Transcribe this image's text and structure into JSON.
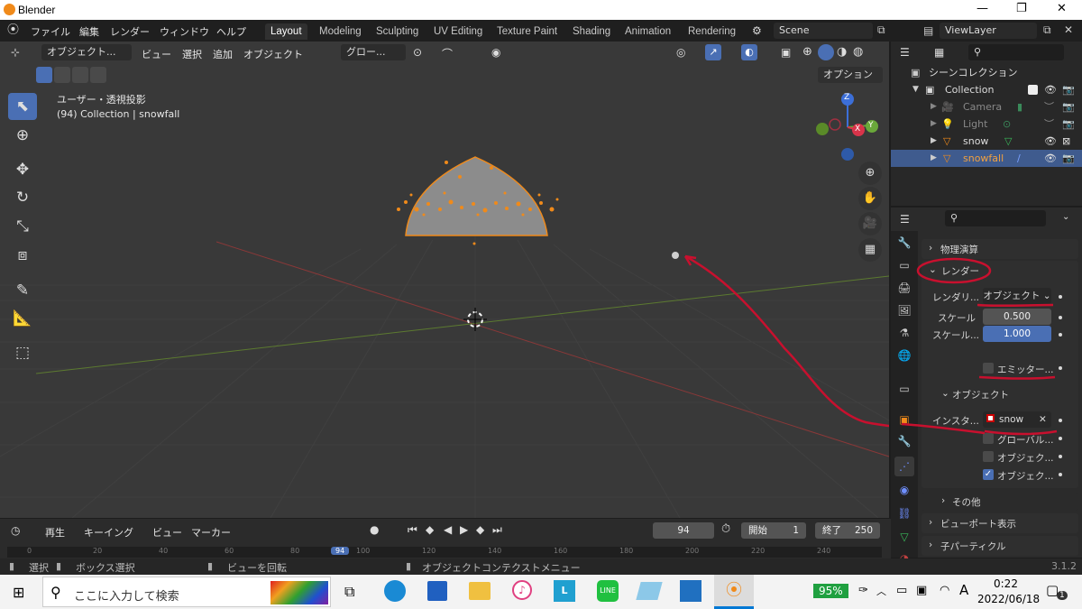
{
  "titlebar": {
    "title": "Blender",
    "minimize": "—",
    "maximize": "❐",
    "close": "✕"
  },
  "menu": {
    "items": [
      "ファイル",
      "編集",
      "レンダー",
      "ウィンドウ",
      "ヘルプ"
    ],
    "workspaces": [
      "Layout",
      "Modeling",
      "Sculpting",
      "UV Editing",
      "Texture Paint",
      "Shading",
      "Animation",
      "Rendering"
    ],
    "scene": "Scene",
    "view_layer": "ViewLayer"
  },
  "viewport": {
    "mode": "オブジェクト...",
    "menus": [
      "ビュー",
      "選択",
      "追加",
      "オブジェクト"
    ],
    "orientation": "グロー...",
    "options_label": "オプション",
    "view_name": "ユーザー・透視投影",
    "collection_info": "(94) Collection | snowfall",
    "gizmo_axes": [
      "Z",
      "Y",
      "X"
    ]
  },
  "outliner": {
    "title": "シーンコレクション",
    "items": [
      {
        "label": "Collection",
        "selected": false
      },
      {
        "label": "Camera",
        "selected": false
      },
      {
        "label": "Light",
        "selected": false
      },
      {
        "label": "snow",
        "selected": false
      },
      {
        "label": "snowfall",
        "selected": true
      }
    ]
  },
  "properties": {
    "physics_label": "物理演算",
    "render_section": "レンダー",
    "render_as_label": "レンダリ...",
    "render_as_value": "オブジェクト",
    "scale_label": "スケール",
    "scale_value": "0.500",
    "scale_random_label": "スケール...",
    "scale_random_value": "1.000",
    "emitter_label": "エミッター...",
    "emitter_checked": false,
    "object_section": "オブジェクト",
    "instance_label": "インスタ...",
    "instance_value": "snow",
    "global_label": "グローバル...",
    "object_rot_label": "オブジェク...",
    "object_scale_label": "オブジェク...",
    "other_label": "その他",
    "viewport_display_label": "ビューポート表示",
    "children_label": "子パーティクル",
    "annotation_color": "#c8102e"
  },
  "timeline": {
    "menus": [
      "再生",
      "キーイング",
      "ビュー",
      "マーカー"
    ],
    "current_frame": "94",
    "start_label": "開始",
    "start": "1",
    "end_label": "終了",
    "end": "250",
    "ruler": [
      "0",
      "20",
      "40",
      "60",
      "80",
      "94",
      "100",
      "120",
      "140",
      "160",
      "180",
      "200",
      "220",
      "240"
    ]
  },
  "statusbar": {
    "select": "選択",
    "box_select": "ボックス選択",
    "rotate_view": "ビューを回転",
    "context_menu": "オブジェクトコンテクストメニュー",
    "version": "3.1.2"
  },
  "taskbar": {
    "search_placeholder": "ここに入力して検索",
    "battery": "95%",
    "ime": "A",
    "time": "0:22",
    "date": "2022/06/18",
    "notifications": "1"
  }
}
